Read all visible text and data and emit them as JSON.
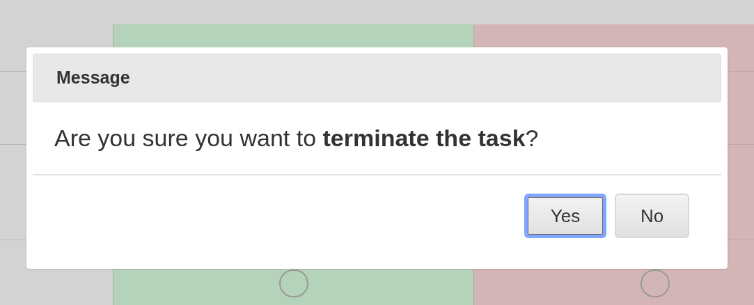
{
  "background": {
    "options": [
      {
        "selected": false
      },
      {
        "selected": false
      }
    ]
  },
  "dialog": {
    "title": "Message",
    "message": "Are you sure you want to **terminate the task**?",
    "buttons": [
      {
        "label": "Yes",
        "focused": true
      },
      {
        "label": "No",
        "focused": false
      }
    ]
  }
}
